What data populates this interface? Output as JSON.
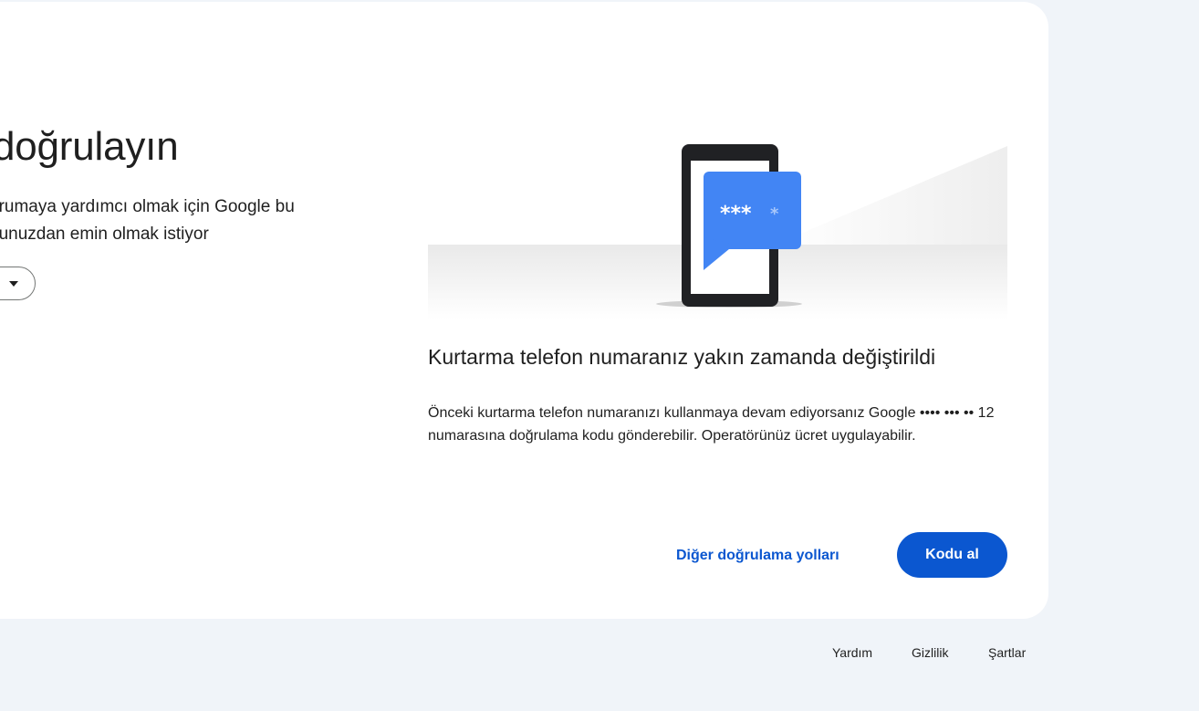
{
  "main": {
    "title": "doğrulayın",
    "subtitle_line1": "orumaya yardımcı olmak için Google bu",
    "subtitle_line2": "ğunuzdan emin olmak istiyor"
  },
  "illustration": {
    "stars": "***"
  },
  "recovery": {
    "heading": "Kurtarma telefon numaranız yakın zamanda değiştirildi",
    "body": "Önceki kurtarma telefon numaranızı kullanmaya devam ediyorsanız Google •••• ••• •• 12 numarasına doğrulama kodu gönderebilir. Operatörünüz ücret uygulayabilir."
  },
  "actions": {
    "other_ways_label": "Diğer doğrulama yolları",
    "get_code_label": "Kodu al"
  },
  "footer": {
    "help": "Yardım",
    "privacy": "Gizlilik",
    "terms": "Şartlar"
  },
  "colors": {
    "primary": "#0b57d0",
    "background": "#f0f4f9",
    "bubble": "#4285f4"
  }
}
